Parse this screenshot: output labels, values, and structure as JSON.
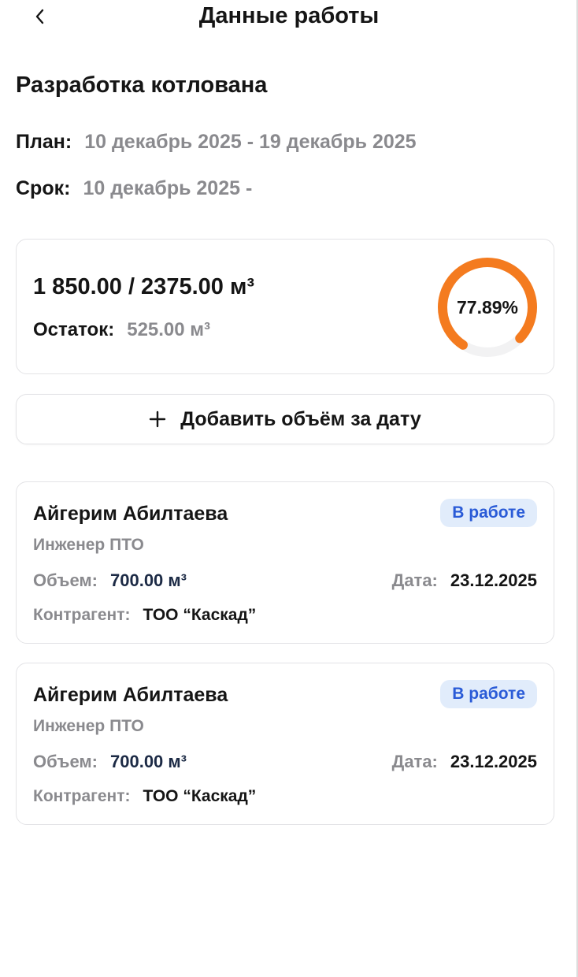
{
  "header": {
    "title": "Данные работы"
  },
  "work": {
    "title": "Разработка котлована",
    "plan_label": "План:",
    "plan_value": "10 декабрь 2025 - 19 декабрь 2025",
    "term_label": "Срок:",
    "term_value": "10 декабрь 2025 -"
  },
  "progress": {
    "volume_text": "1 850.00 / 2375.00 м³",
    "remain_label": "Остаток:",
    "remain_value": "525.00 м³",
    "percent_label": "77.89%",
    "percent_value": 77.89,
    "accent_color": "#f47b1f",
    "track_color": "#f2f2f3"
  },
  "add_button": {
    "label": "Добавить объём за дату"
  },
  "entries": [
    {
      "name": "Айгерим Абилтаева",
      "role": "Инженер ПТО",
      "status": "В работе",
      "volume_label": "Объем:",
      "volume_value": "700.00 м³",
      "date_label": "Дата:",
      "date_value": "23.12.2025",
      "contractor_label": "Контрагент:",
      "contractor_value": "ТОО “Каскад”"
    },
    {
      "name": "Айгерим Абилтаева",
      "role": "Инженер ПТО",
      "status": "В работе",
      "volume_label": "Объем:",
      "volume_value": "700.00 м³",
      "date_label": "Дата:",
      "date_value": "23.12.2025",
      "contractor_label": "Контрагент:",
      "contractor_value": "ТОО “Каскад”"
    }
  ]
}
